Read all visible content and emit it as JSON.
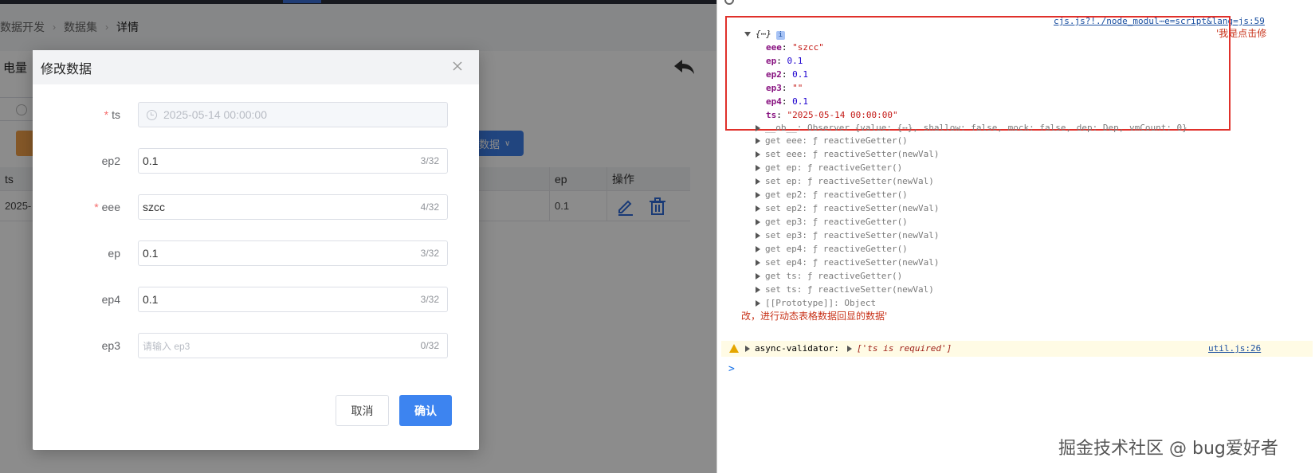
{
  "breadcrumb": [
    "数据开发",
    "数据集",
    "详情"
  ],
  "page": {
    "card_title": "电量",
    "data_button": "数据"
  },
  "table": {
    "headers": [
      "ts",
      "ep",
      "操作"
    ],
    "row": {
      "ts": "2025-",
      "ep": "0.1"
    }
  },
  "dialog": {
    "title": "修改数据",
    "fields": [
      {
        "label": "ts",
        "required": true,
        "value": "2025-05-14 00:00:00",
        "disabled": true,
        "count": ""
      },
      {
        "label": "ep2",
        "required": false,
        "value": "0.1",
        "count": "3/32"
      },
      {
        "label": "eee",
        "required": true,
        "value": "szcc",
        "count": "4/32"
      },
      {
        "label": "ep",
        "required": false,
        "value": "0.1",
        "count": "3/32"
      },
      {
        "label": "ep4",
        "required": false,
        "value": "0.1",
        "count": "3/32"
      },
      {
        "label": "ep3",
        "required": false,
        "value": "",
        "placeholder": "请输入 ep3",
        "count": "0/32"
      }
    ],
    "required_mark": "*",
    "cancel_label": "取消",
    "confirm_label": "确认"
  },
  "devtools": {
    "source_link": "cjs.js?!./node_modul⋯e=script&lang=js:59",
    "log_msg_1": "'我是点击修",
    "log_msg_2": "改，进行动态表格数据回显的数据'",
    "object_preview": "{⋯}",
    "props": [
      {
        "key": "eee",
        "value": "\"szcc\"",
        "type": "str"
      },
      {
        "key": "ep",
        "value": "0.1",
        "type": "num"
      },
      {
        "key": "ep2",
        "value": "0.1",
        "type": "num"
      },
      {
        "key": "ep3",
        "value": "\"\"",
        "type": "str"
      },
      {
        "key": "ep4",
        "value": "0.1",
        "type": "num"
      },
      {
        "key": "ts",
        "value": "\"2025-05-14 00:00:00\"",
        "type": "str"
      }
    ],
    "observer_line": "__ob__: Observer  {value: {⋯}, shallow: false, mock: false, dep: Dep, vmCount: 0}",
    "accessors": [
      "get eee: ƒ reactiveGetter()",
      "set eee: ƒ reactiveSetter(newVal)",
      "get ep: ƒ reactiveGetter()",
      "set ep: ƒ reactiveSetter(newVal)",
      "get ep2: ƒ reactiveGetter()",
      "set ep2: ƒ reactiveSetter(newVal)",
      "get ep3: ƒ reactiveGetter()",
      "set ep3: ƒ reactiveSetter(newVal)",
      "get ep4: ƒ reactiveGetter()",
      "set ep4: ƒ reactiveSetter(newVal)",
      "get ts: ƒ reactiveGetter()",
      "set ts: ƒ reactiveSetter(newVal)"
    ],
    "prototype_line": "[[Prototype]]: Object",
    "warning_text": "async-validator:",
    "warning_array": "['ts is required']",
    "warning_link": "util.js:26",
    "prompt_symbol": ">"
  },
  "watermark": "掘金技术社区 @ bug爱好者",
  "colors": {
    "primary": "#3d84f0",
    "highlight_box": "#e0302a",
    "required": "#f56c6c"
  }
}
